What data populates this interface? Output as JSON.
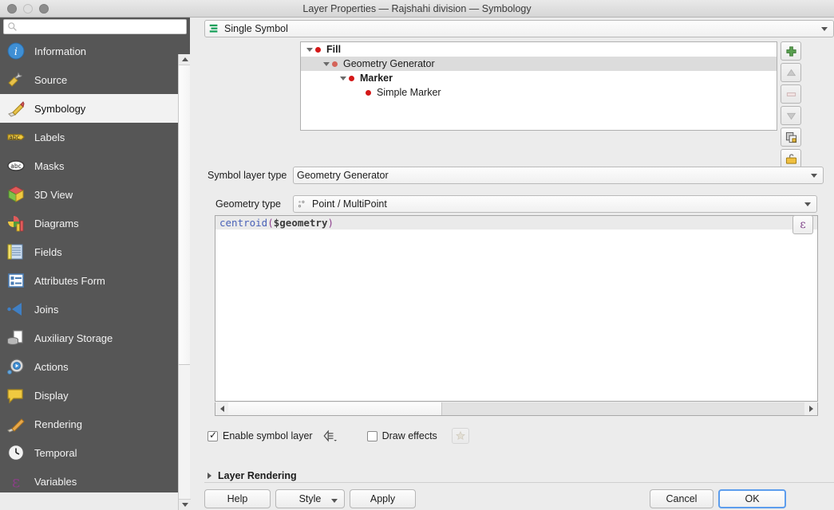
{
  "window": {
    "title": "Layer Properties — Rajshahi division — Symbology",
    "traffic_lights": [
      "close",
      "minimize",
      "maximize"
    ]
  },
  "sidebar": {
    "search": {
      "value": "",
      "placeholder": ""
    },
    "items": [
      {
        "label": "Information",
        "icon": "information-icon",
        "selected": false
      },
      {
        "label": "Source",
        "icon": "source-icon",
        "selected": false
      },
      {
        "label": "Symbology",
        "icon": "symbology-icon",
        "selected": true
      },
      {
        "label": "Labels",
        "icon": "labels-icon",
        "selected": false
      },
      {
        "label": "Masks",
        "icon": "masks-icon",
        "selected": false
      },
      {
        "label": "3D View",
        "icon": "3d-view-icon",
        "selected": false
      },
      {
        "label": "Diagrams",
        "icon": "diagrams-icon",
        "selected": false
      },
      {
        "label": "Fields",
        "icon": "fields-icon",
        "selected": false
      },
      {
        "label": "Attributes Form",
        "icon": "attributes-form-icon",
        "selected": false
      },
      {
        "label": "Joins",
        "icon": "joins-icon",
        "selected": false
      },
      {
        "label": "Auxiliary Storage",
        "icon": "auxiliary-storage-icon",
        "selected": false
      },
      {
        "label": "Actions",
        "icon": "actions-icon",
        "selected": false
      },
      {
        "label": "Display",
        "icon": "display-icon",
        "selected": false
      },
      {
        "label": "Rendering",
        "icon": "rendering-icon",
        "selected": false
      },
      {
        "label": "Temporal",
        "icon": "temporal-icon",
        "selected": false
      },
      {
        "label": "Variables",
        "icon": "variables-icon",
        "selected": false
      }
    ]
  },
  "renderer": {
    "selected": "Single Symbol",
    "icon": "single-symbol-icon"
  },
  "symbol_tree": {
    "rows": [
      {
        "label": "Fill",
        "depth": 0,
        "bold": true,
        "selected": false,
        "expanded": true,
        "dot_color": "#d41818"
      },
      {
        "label": "Geometry Generator",
        "depth": 1,
        "bold": false,
        "selected": true,
        "expanded": true,
        "dot_color": "#d4645a"
      },
      {
        "label": "Marker",
        "depth": 2,
        "bold": true,
        "selected": false,
        "expanded": true,
        "dot_color": "#d41818"
      },
      {
        "label": "Simple Marker",
        "depth": 3,
        "bold": false,
        "selected": false,
        "expanded": false,
        "dot_color": "#d41818"
      }
    ],
    "buttons": [
      {
        "name": "add-symbol-layer-button",
        "icon": "plus-icon",
        "enabled": true
      },
      {
        "name": "move-up-button",
        "icon": "arrow-up-icon",
        "enabled": false
      },
      {
        "name": "remove-symbol-layer-button",
        "icon": "minus-icon",
        "enabled": false
      },
      {
        "name": "move-down-button",
        "icon": "arrow-down-icon",
        "enabled": false
      },
      {
        "name": "duplicate-symbol-layer-button",
        "icon": "copy-icon",
        "enabled": true
      },
      {
        "name": "lock-layer-button",
        "icon": "unlocked-folder-icon",
        "enabled": true
      }
    ]
  },
  "form": {
    "symbol_layer_type_label": "Symbol layer type",
    "symbol_layer_type_value": "Geometry Generator",
    "geometry_type_label": "Geometry type",
    "geometry_type_value": "Point / MultiPoint",
    "geometry_type_icon": "point-multipoint-icon"
  },
  "expression": {
    "tokens": [
      {
        "text": "centroid",
        "kind": "function"
      },
      {
        "text": "(",
        "kind": "paren"
      },
      {
        "text": "$geometry",
        "kind": "variable"
      },
      {
        "text": ")",
        "kind": "paren"
      }
    ],
    "full_text": "centroid($geometry)",
    "expression_button_label": "ε"
  },
  "options": {
    "enable_symbol_layer_label": "Enable symbol layer",
    "enable_symbol_layer_checked": true,
    "data_defined_override_icon": "data-defined-override-icon",
    "draw_effects_label": "Draw effects",
    "draw_effects_checked": false,
    "draw_effects_button_icon": "effects-star-icon"
  },
  "layer_rendering": {
    "label": "Layer Rendering",
    "expanded": false
  },
  "buttons": {
    "help": "Help",
    "style": "Style",
    "apply": "Apply",
    "cancel": "Cancel",
    "ok": "OK"
  },
  "colors": {
    "sidebar_bg": "#565656",
    "selection": "#dcdcdc",
    "accent": "#5c9ded",
    "symbol_red": "#d41818",
    "function_blue": "#4a62b8",
    "paren_purple": "#8d3f8d"
  }
}
